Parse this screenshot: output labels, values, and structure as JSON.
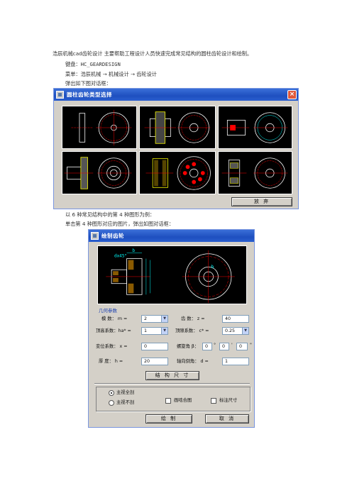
{
  "doc": {
    "intro": "浩辰机械cad齿轮设计 主要帮助工程设计人员快速完成常见结构的圆柱齿轮设计和绘制。",
    "keyboard": "键盘：HC_GEARDESIGN",
    "menu": "菜单：浩辰机械 → 机械设计 → 齿轮设计",
    "popup": "弹出如下图对话框：",
    "example": "以 6 种常见结构中的第 4 种图形为例：",
    "click": "单击第 4 种图形对应的图片，弹出如图对话框："
  },
  "dialog1": {
    "title": "圆柱齿轮类型选择",
    "cancel": "放 弃"
  },
  "dialog2": {
    "title": "绘制齿轮",
    "group": "几何参数",
    "params": {
      "module_label": "模  数：  m =",
      "module_value": "2",
      "teeth_label": "齿  数：  z =",
      "teeth_value": "40",
      "addendum_label": "顶高系数：ha* =",
      "addendum_value": "1",
      "clearance_label": "顶隙系数：  c* =",
      "clearance_value": "0.25",
      "shift_label": "变位系数：  x =",
      "shift_value": "0",
      "helix_label": "螺旋角 β：",
      "helix_deg": "0",
      "helix_min": "0",
      "helix_sec": "0",
      "deg_unit": "°",
      "min_unit": "'",
      "sec_unit": "\"",
      "thickness_label": "厚  度：   h =",
      "thickness_value": "20",
      "bore_label": "轴向倒角：  d =",
      "bore_value": "1"
    },
    "struct_button": "结 构 尺 寸",
    "opt_full": "主视全剖",
    "opt_none": "主视不剖",
    "chk_table": "画啮合图",
    "chk_dims": "标注尺寸",
    "ok": "绘 制",
    "cancel": "取 消"
  }
}
